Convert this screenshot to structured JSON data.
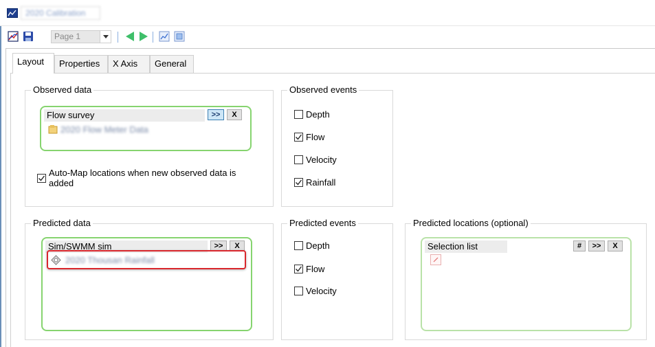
{
  "window": {
    "title": "2020 Calibration"
  },
  "toolbar": {
    "page_select": "Page 1"
  },
  "tabs": [
    {
      "label": "Layout",
      "active": true
    },
    {
      "label": "Properties",
      "active": false
    },
    {
      "label": "X Axis",
      "active": false
    },
    {
      "label": "General",
      "active": false
    }
  ],
  "observed_data": {
    "legend": "Observed data",
    "list_header": "Flow survey",
    "expand_label": ">>",
    "remove_label": "X",
    "item": "2020 Flow Meter Data",
    "auto_map_label": "Auto-Map locations when new observed data is added",
    "auto_map_checked": true
  },
  "observed_events": {
    "legend": "Observed events",
    "items": [
      {
        "label": "Depth",
        "checked": false
      },
      {
        "label": "Flow",
        "checked": true
      },
      {
        "label": "Velocity",
        "checked": false
      },
      {
        "label": "Rainfall",
        "checked": true
      }
    ]
  },
  "predicted_data": {
    "legend": "Predicted data",
    "list_header": "Sim/SWMM sim",
    "expand_label": ">>",
    "remove_label": "X",
    "item": "2020 Thousan Rainfall"
  },
  "predicted_events": {
    "legend": "Predicted events",
    "items": [
      {
        "label": "Depth",
        "checked": false
      },
      {
        "label": "Flow",
        "checked": true
      },
      {
        "label": "Velocity",
        "checked": false
      }
    ]
  },
  "predicted_locations": {
    "legend": "Predicted locations (optional)",
    "list_header": "Selection list",
    "hash_label": "#",
    "expand_label": ">>",
    "remove_label": "X"
  },
  "colors": {
    "list_border": "#86d46f",
    "highlight": "#d9262c",
    "accent": "#1f3f8f"
  }
}
